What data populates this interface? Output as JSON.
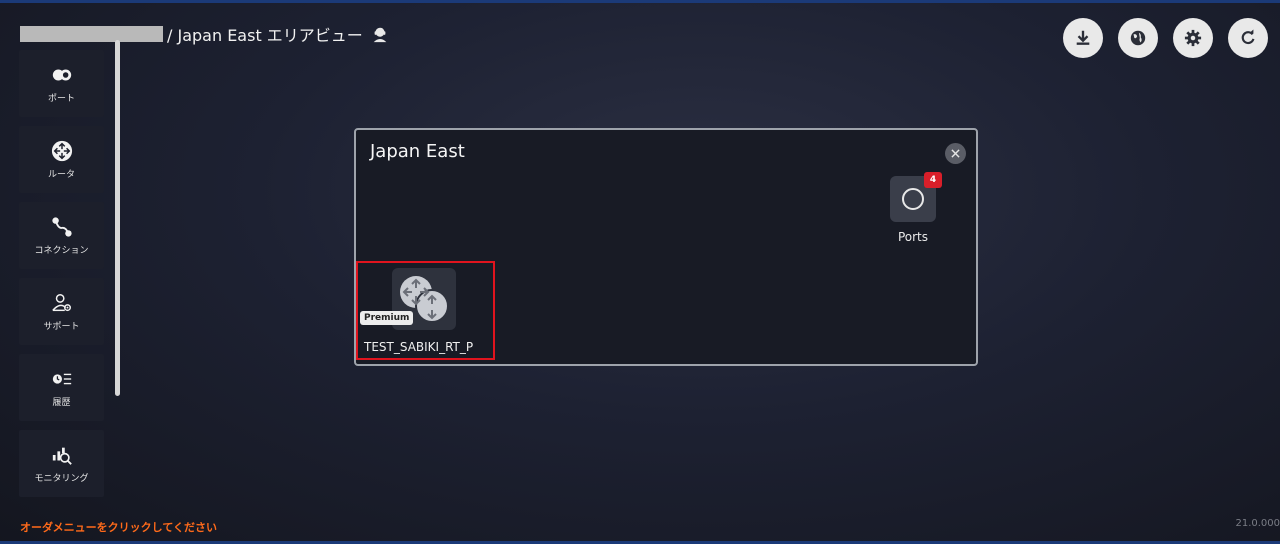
{
  "header": {
    "title": "/ Japan East エリアビュー",
    "user_icon": "support-agent-icon"
  },
  "sidebar": {
    "items": [
      {
        "label": "ポート",
        "icon": "port-icon"
      },
      {
        "label": "ルータ",
        "icon": "router-icon"
      },
      {
        "label": "コネクション",
        "icon": "connection-icon"
      },
      {
        "label": "サポート",
        "icon": "support-icon"
      },
      {
        "label": "履歴",
        "icon": "history-icon"
      },
      {
        "label": "モニタリング",
        "icon": "monitoring-icon"
      }
    ]
  },
  "toolbar": {
    "buttons": [
      "download-icon",
      "globe-icon",
      "gear-icon",
      "refresh-icon"
    ]
  },
  "panel": {
    "title": "Japan East",
    "ports": {
      "label": "Ports",
      "count": "4"
    },
    "router": {
      "badge": "Premium",
      "name": "TEST_SABIKI_RT_P"
    }
  },
  "footer": {
    "hint": "オーダメニューをクリックしてください",
    "version": "21.0.000"
  },
  "colors": {
    "accent_red": "#e0141e",
    "hint_orange": "#ff6a1a",
    "badge_red": "#d91f2a"
  }
}
